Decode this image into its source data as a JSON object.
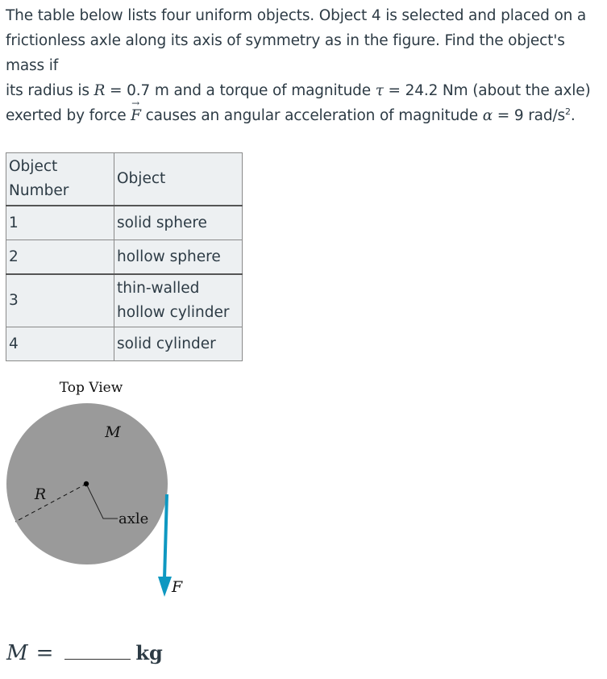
{
  "problem": {
    "line1": "The table below lists four uniform objects. Object 4 is selected and placed on a",
    "line2": "frictionless axle along its axis of symmetry as in the figure. Find the object's mass if",
    "line3_a": "its radius is ",
    "R_symbol": "R",
    "eq": " = ",
    "R_value": "0.7 m",
    "line3_b": " and a torque of magnitude ",
    "tau_symbol": "τ",
    "tau_value": "24.2 Nm (about the axle)",
    "line4_a": "exerted by force ",
    "F_symbol": "F",
    "line4_b": " causes an angular acceleration of magnitude ",
    "alpha_symbol": "α",
    "alpha_value": "9 rad/s",
    "alpha_exp": "2",
    "period": "."
  },
  "table": {
    "headers": [
      "Object Number",
      "Object"
    ],
    "rows": [
      {
        "number": "1",
        "object": "solid sphere"
      },
      {
        "number": "2",
        "object": "hollow sphere"
      },
      {
        "number": "3",
        "object": "thin-walled hollow cylinder"
      },
      {
        "number": "4",
        "object": "solid cylinder"
      }
    ]
  },
  "figure": {
    "title": "Top View",
    "mass_label": "M",
    "radius_label": "R",
    "axle_label": "axle",
    "force_label": "F",
    "disk_color": "#9a9a9a",
    "arrow_color": "#0e98c1"
  },
  "answer": {
    "symbol": "M",
    "equals": "=",
    "value": "",
    "unit": "kg"
  }
}
